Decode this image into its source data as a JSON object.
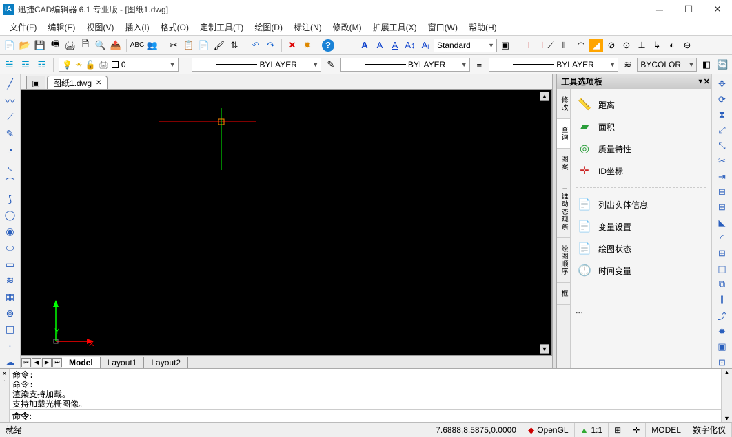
{
  "title": "迅捷CAD编辑器 6.1 专业版  - [图纸1.dwg]",
  "menu": [
    "文件(F)",
    "编辑(E)",
    "视图(V)",
    "插入(I)",
    "格式(O)",
    "定制工具(T)",
    "绘图(D)",
    "标注(N)",
    "修改(M)",
    "扩展工具(X)",
    "窗口(W)",
    "帮助(H)"
  ],
  "tab_file": "图纸1.dwg",
  "layer_combo_value": "0",
  "linetype1": "BYLAYER",
  "linetype2": "BYLAYER",
  "linetype3": "BYLAYER",
  "style_combo": "Standard",
  "bycolor": "BYCOLOR",
  "axis": {
    "x": "X",
    "y": "Y"
  },
  "layout_tabs": {
    "model": "Model",
    "l1": "Layout1",
    "l2": "Layout2"
  },
  "panel": {
    "title": "工具选项板",
    "vtabs": [
      "修改",
      "查询",
      "图案",
      "三维动态观察",
      "绘图顺序",
      "框"
    ],
    "items1": [
      {
        "label": "距离",
        "icon": "↔"
      },
      {
        "label": "面积",
        "icon": "▭"
      },
      {
        "label": "质量特性",
        "icon": "◎"
      },
      {
        "label": "ID坐标",
        "icon": "✛"
      }
    ],
    "items2": [
      {
        "label": "列出实体信息",
        "icon": "📄"
      },
      {
        "label": "变量设置",
        "icon": "📄"
      },
      {
        "label": "绘图状态",
        "icon": "📄"
      },
      {
        "label": "时间变量",
        "icon": "🕒"
      }
    ]
  },
  "command_log": "命令:\n命令:\n渲染支持加载。\n支持加载光栅图像。",
  "command_prompt": "命令:",
  "status": {
    "ready": "就绪",
    "coords": "7.6888,8.5875,0.0000",
    "opengl": "OpenGL",
    "scale": "1:1",
    "model": "MODEL",
    "digit": "数字化仪"
  }
}
